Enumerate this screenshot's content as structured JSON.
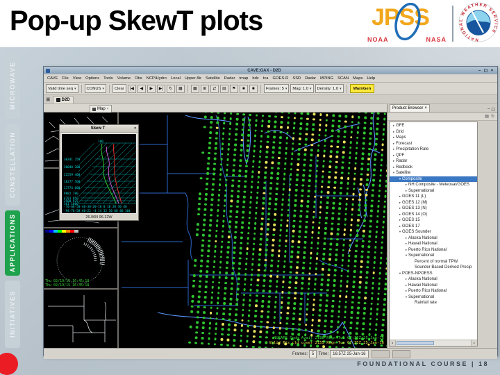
{
  "slide": {
    "title": "Pop-up SkewT plots",
    "footer": "FOUNDATIONAL COURSE | 18"
  },
  "logos": {
    "jpss_text": "JPSS",
    "jpss_noaa": "NOAA",
    "jpss_nasa": "NASA",
    "nws_ring_text": "NATIONAL WEATHER SERVICE"
  },
  "sidebar": {
    "active_color": "#1fa24d",
    "items": [
      {
        "label": "MICROWAVE",
        "active": false
      },
      {
        "label": "CONSTELLATION",
        "active": false
      },
      {
        "label": "APPLICATIONS",
        "active": true
      },
      {
        "label": "INITIATIVES",
        "active": false
      }
    ]
  },
  "icons": {
    "minimize": "–",
    "maximize": "▢",
    "close": "×",
    "dropdown": "▾",
    "tab_close": "×",
    "folder": "▣",
    "tree_closed": "▸",
    "tree_open": "▾",
    "collapse_all": "▤",
    "refresh": "↻",
    "scroll_left": "◂",
    "scroll_right": "▸"
  },
  "app": {
    "window_title": "CAVE:OAX - D2D",
    "menus": [
      "CAVE",
      "File",
      "View",
      "Options",
      "Tools",
      "Volume",
      "Obs",
      "NCP/Hydro",
      "Local",
      "Upper Air",
      "Satellite",
      "Radar",
      "tmap",
      "bdc",
      "tca",
      "GOES-R",
      "SSD",
      "Radar",
      "MPING",
      "SCAN",
      "Maps",
      "Help"
    ],
    "toolbar": {
      "valid_time": "Valid time seq",
      "scale": "CONUS",
      "clear": "Clear",
      "nav_icons": [
        "|◀",
        "◀",
        "▶",
        "▶|",
        "↻",
        "▦"
      ],
      "tool_icons": [
        "▦",
        "⊞",
        "⇄",
        "▤",
        "⚑",
        "■",
        "■"
      ],
      "frames": "Frames: 5",
      "mag": "Mag: 1.0",
      "density": "Density: 1.0",
      "warngen": "WarnGen"
    },
    "perspective_tab": "D2D",
    "map_tab": "Map",
    "thumbnails": {
      "colorbar": [
        "#00007f",
        "#0000ff",
        "#00bfff",
        "#00ff00",
        "#ffff00",
        "#ff7f00",
        "#ff0000",
        "#bfbfbf"
      ],
      "globe_times": "Thu 02/19/15 16:45:18\nThu 02/19/15 16:45:18"
    },
    "map": {
      "dot_green": "#2ec32e",
      "dot_yellow": "#e3e05a",
      "legend_green": "#3ddc3d",
      "legend_yellow": "#e8e44a",
      "legend_line1": "NUCAPS Sndg Avail 2188 Regn Tue 07:35Z 25-Jan-16",
      "legend_line2": "Valid Pts cld cover 2155 Regn Tue 07:35Z 25-Jan-16"
    },
    "skewt": {
      "title": "Skew T",
      "top_label": "100",
      "left_labels": [
        "30341 250",
        "30048 300",
        "22559 400",
        "18277 500",
        "13774 600",
        "9882 700",
        "4781 850",
        "2500 925",
        "361 1000"
      ],
      "temp_row_c": "-70-60-50-40-30-20-10 0 10 20 30 40",
      "temp_row_f": "-94-76-58-40-22 -4 14 32 50 68 86 104",
      "coords": "26.96N 96.12W"
    },
    "product_browser": {
      "tab": "Product Browser",
      "tree": [
        {
          "label": "GFE",
          "level": 0,
          "exp": "c"
        },
        {
          "label": "Grid",
          "level": 0,
          "exp": "c"
        },
        {
          "label": "Maps",
          "level": 0,
          "exp": "c"
        },
        {
          "label": "Forecast",
          "level": 0,
          "exp": "c"
        },
        {
          "label": "Precipitation Rate",
          "level": 0,
          "exp": "c"
        },
        {
          "label": "QPF",
          "level": 0,
          "exp": "c"
        },
        {
          "label": "Radar",
          "level": 0,
          "exp": "c"
        },
        {
          "label": "Redbook",
          "level": 0,
          "exp": "c"
        },
        {
          "label": "Satellite",
          "level": 0,
          "exp": "o"
        },
        {
          "label": "Composite",
          "level": 1,
          "exp": "o",
          "selected": true
        },
        {
          "label": "NH Composite - Meteosat/GOES",
          "level": 2,
          "exp": "c"
        },
        {
          "label": "Supernational",
          "level": 2,
          "exp": "c"
        },
        {
          "label": "GOES 11 (L)",
          "level": 1,
          "exp": "c"
        },
        {
          "label": "GOES 12 (M)",
          "level": 1,
          "exp": "c"
        },
        {
          "label": "GOES 13 (N)",
          "level": 1,
          "exp": "c"
        },
        {
          "label": "GOES 14 (O)",
          "level": 1,
          "exp": "c"
        },
        {
          "label": "GOES 15",
          "level": 1,
          "exp": "c"
        },
        {
          "label": "GOES 17",
          "level": 1,
          "exp": "c"
        },
        {
          "label": "GOES Sounder",
          "level": 1,
          "exp": "o"
        },
        {
          "label": "Alaska National",
          "level": 2,
          "exp": "c"
        },
        {
          "label": "Hawaii National",
          "level": 2,
          "exp": "c"
        },
        {
          "label": "Puerto Rico National",
          "level": 2,
          "exp": "c"
        },
        {
          "label": "Supernational",
          "level": 2,
          "exp": "o"
        },
        {
          "label": "Percent of normal TPW",
          "level": 3,
          "exp": "n"
        },
        {
          "label": "Sounder Based Derived Precip",
          "level": 3,
          "exp": "n"
        },
        {
          "label": "POES-NPOESS",
          "level": 1,
          "exp": "o"
        },
        {
          "label": "Alaska National",
          "level": 2,
          "exp": "c"
        },
        {
          "label": "Hawaii National",
          "level": 2,
          "exp": "c"
        },
        {
          "label": "Puerto Rico National",
          "level": 2,
          "exp": "c"
        },
        {
          "label": "Supernational",
          "level": 2,
          "exp": "o"
        },
        {
          "label": "Rainfall rate",
          "level": 3,
          "exp": "n"
        }
      ]
    },
    "status": {
      "frames_label": "Frames:",
      "frames_value": "5",
      "time_label": "Time:",
      "time_value": "16:57Z 25-Jan-16"
    }
  }
}
